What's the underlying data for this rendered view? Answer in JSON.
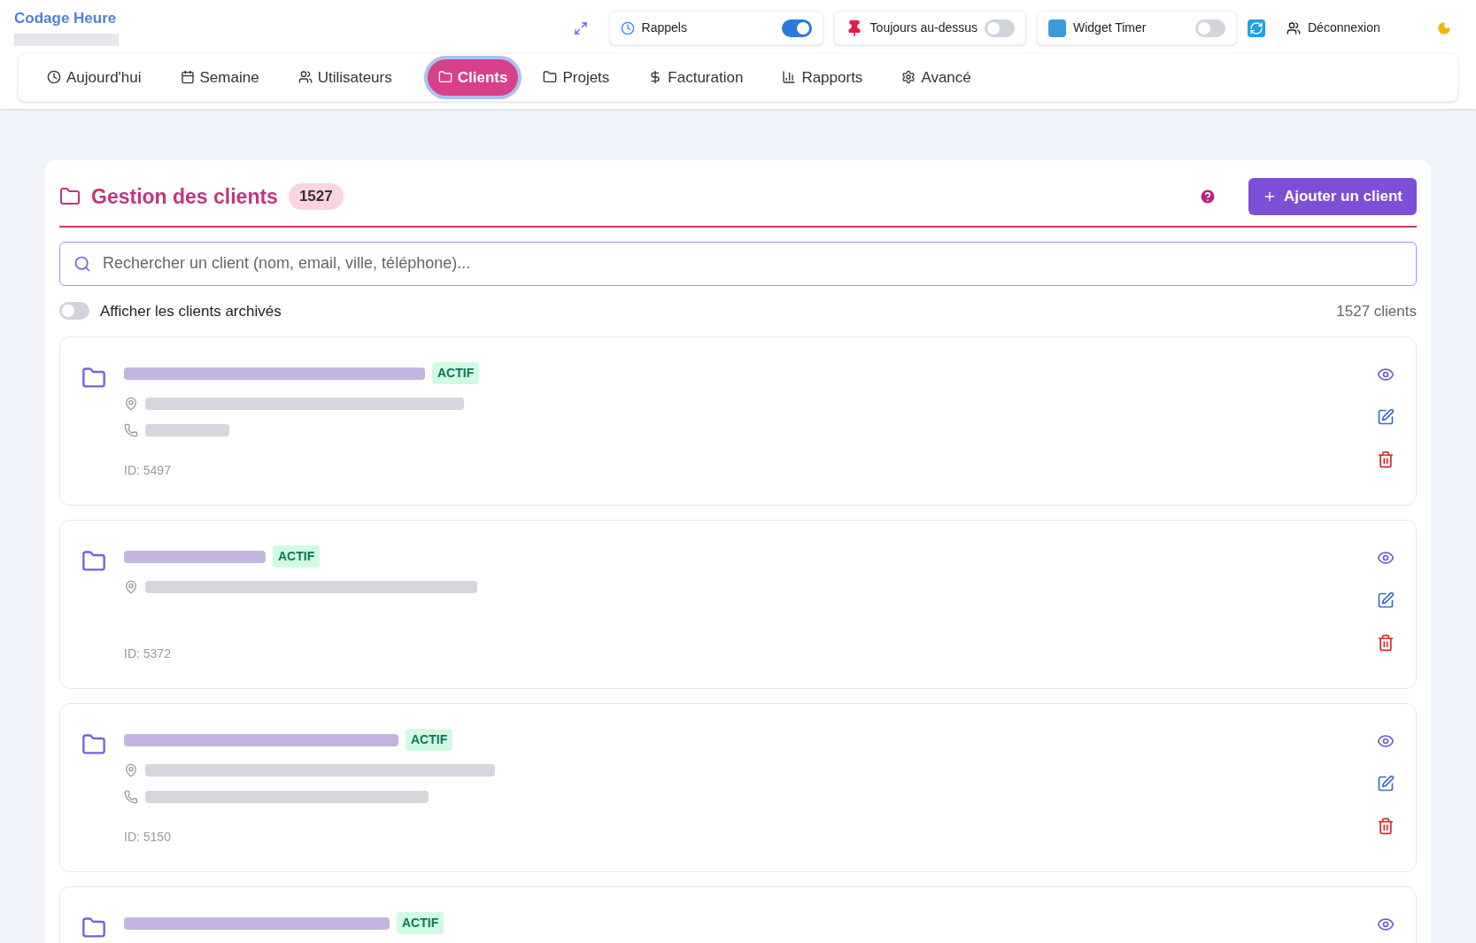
{
  "app": {
    "title": "Codage Heure"
  },
  "toolbar": [
    {
      "kind": "toggle",
      "label": "Rappels",
      "on": true
    },
    {
      "kind": "toggle",
      "label": "Toujours au-dessus",
      "on": false
    },
    {
      "kind": "toggle",
      "label": "Widget Timer",
      "on": false
    }
  ],
  "logout": "Déconnexion",
  "tabs": [
    {
      "label": "Aujourd'hui",
      "selected": false
    },
    {
      "label": "Semaine",
      "selected": false
    },
    {
      "label": "Utilisateurs",
      "selected": false
    },
    {
      "label": "Clients",
      "selected": true
    },
    {
      "label": "Projets",
      "selected": false
    },
    {
      "label": "Facturation",
      "selected": false
    },
    {
      "label": "Rapports",
      "selected": false
    },
    {
      "label": "Avancé",
      "selected": false
    }
  ],
  "panel": {
    "title": "Gestion des clients",
    "count": "1527",
    "add_button": "Ajouter un client",
    "search": {
      "placeholder": "Rechercher un client (nom, email, ville, téléphone)..."
    },
    "archived_toggle": {
      "label": "Afficher les clients archivés",
      "on": false
    },
    "total": "1527 clients"
  },
  "clients": [
    {
      "status": "ACTIF",
      "id": "ID: 5497",
      "details": [
        {
          "kind": "address"
        },
        {
          "kind": "phone"
        }
      ]
    },
    {
      "status": "ACTIF",
      "id": "ID: 5372",
      "details": [
        {
          "kind": "address"
        }
      ]
    },
    {
      "status": "ACTIF",
      "id": "ID: 5150",
      "details": [
        {
          "kind": "address"
        },
        {
          "kind": "phone"
        }
      ]
    },
    {
      "status": "ACTIF"
    }
  ]
}
